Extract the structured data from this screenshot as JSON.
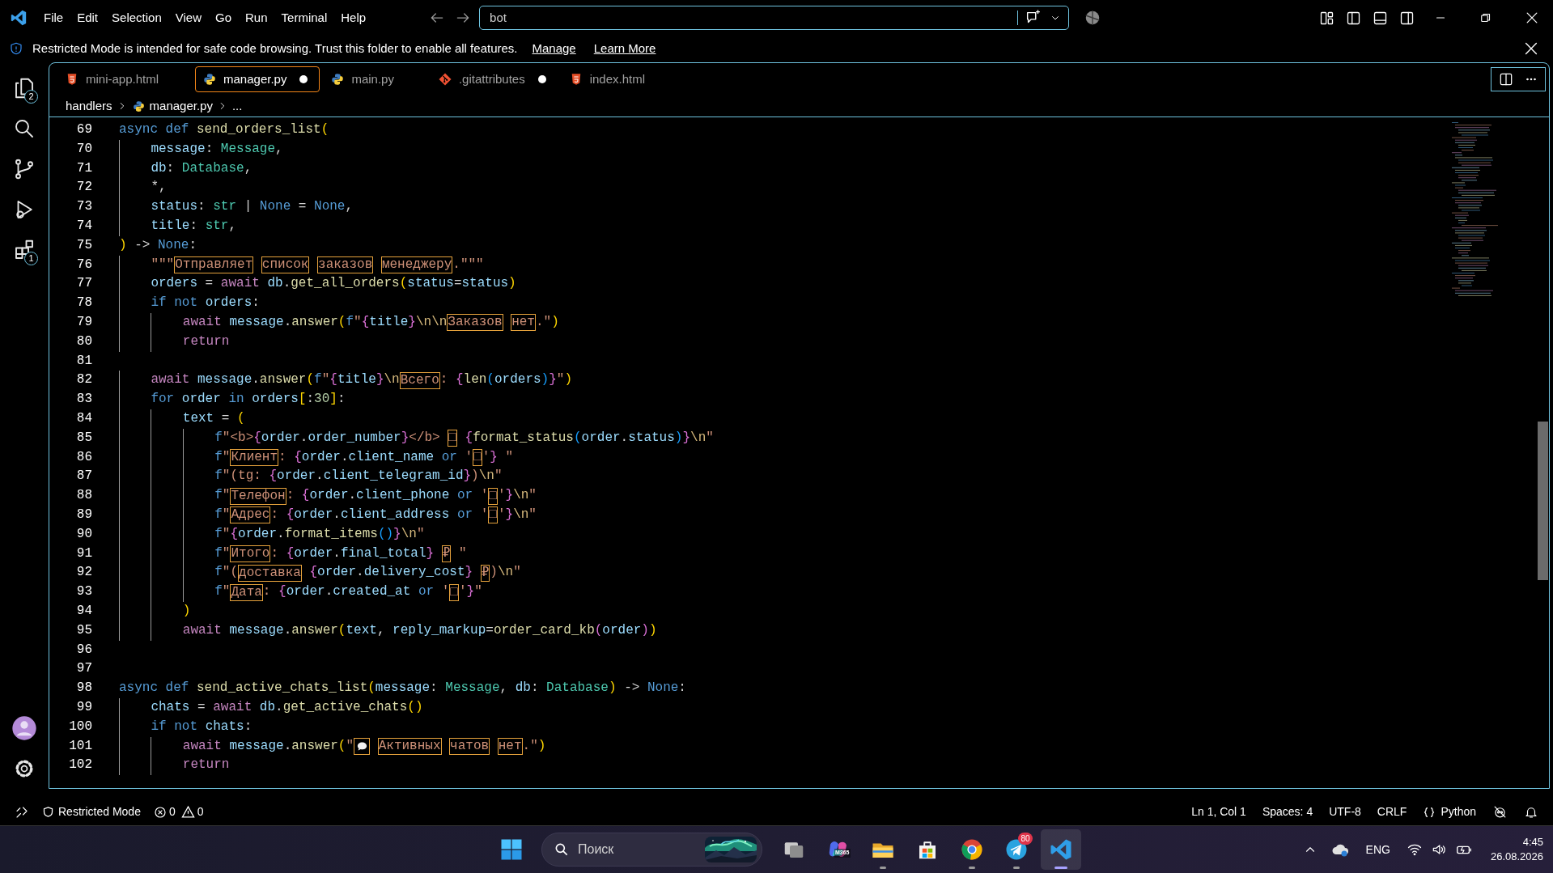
{
  "menu": [
    "File",
    "Edit",
    "Selection",
    "View",
    "Go",
    "Run",
    "Terminal",
    "Help"
  ],
  "command_center": {
    "value": "bot"
  },
  "banner": {
    "message": "Restricted Mode is intended for safe code browsing. Trust this folder to enable all features.",
    "links": [
      "Manage",
      "Learn More"
    ]
  },
  "activity_bar": [
    {
      "kind": "files",
      "badge": "2"
    },
    {
      "kind": "search"
    },
    {
      "kind": "source_control"
    },
    {
      "kind": "run"
    },
    {
      "kind": "extensions",
      "badge": "1"
    }
  ],
  "activity_bar_bottom": [
    {
      "kind": "account"
    },
    {
      "kind": "settings"
    }
  ],
  "tabs": [
    {
      "label": "mini-app.html",
      "kind": "html",
      "selected": false,
      "modified": false
    },
    {
      "label": "manager.py",
      "kind": "python",
      "selected": true,
      "modified": true
    },
    {
      "label": "main.py",
      "kind": "python",
      "selected": false,
      "modified": false
    },
    {
      "label": ".gitattributes",
      "kind": "git",
      "selected": false,
      "modified": true
    },
    {
      "label": "index.html",
      "kind": "html",
      "selected": false,
      "modified": false
    }
  ],
  "breadcrumbs": [
    {
      "label": "handlers",
      "kind": "folder"
    },
    {
      "label": "manager.py",
      "kind": "python"
    },
    {
      "label": "...",
      "kind": "symbol"
    }
  ],
  "editor": {
    "lines": [
      {
        "number": "69",
        "tokens": [
          {
            "kind": "kw",
            "text": "async def "
          },
          {
            "kind": "fn",
            "text": "send_orders_list"
          },
          {
            "kind": "b1",
            "text": "("
          }
        ]
      },
      {
        "number": "70",
        "tokens": [
          {
            "kind": "var",
            "text": "    message"
          },
          {
            "kind": "p",
            "text": ": "
          },
          {
            "kind": "type",
            "text": "Message"
          },
          {
            "kind": "p",
            "text": ","
          }
        ]
      },
      {
        "number": "71",
        "tokens": [
          {
            "kind": "var",
            "text": "    db"
          },
          {
            "kind": "p",
            "text": ": "
          },
          {
            "kind": "type",
            "text": "Database"
          },
          {
            "kind": "p",
            "text": ","
          }
        ]
      },
      {
        "number": "72",
        "tokens": [
          {
            "kind": "p",
            "text": "    *,"
          }
        ]
      },
      {
        "number": "73",
        "tokens": [
          {
            "kind": "var",
            "text": "    status"
          },
          {
            "kind": "p",
            "text": ": "
          },
          {
            "kind": "type",
            "text": "str"
          },
          {
            "kind": "p",
            "text": " | "
          },
          {
            "kind": "kw",
            "text": "None"
          },
          {
            "kind": "p",
            "text": " = "
          },
          {
            "kind": "kw",
            "text": "None"
          },
          {
            "kind": "p",
            "text": ","
          }
        ]
      },
      {
        "number": "74",
        "tokens": [
          {
            "kind": "var",
            "text": "    title"
          },
          {
            "kind": "p",
            "text": ": "
          },
          {
            "kind": "type",
            "text": "str"
          },
          {
            "kind": "p",
            "text": ","
          }
        ]
      },
      {
        "number": "75",
        "tokens": [
          {
            "kind": "b1",
            "text": ")"
          },
          {
            "kind": "p",
            "text": " -> "
          },
          {
            "kind": "kw",
            "text": "None"
          },
          {
            "kind": "p",
            "text": ":"
          }
        ]
      },
      {
        "number": "76",
        "tokens": [
          {
            "kind": "str",
            "text": "    \"\"\""
          },
          {
            "kind": "box",
            "text": "Отправляет "
          },
          {
            "kind": "box",
            "text": "список "
          },
          {
            "kind": "box",
            "text": "заказов "
          },
          {
            "kind": "box",
            "text": "менеджеру"
          },
          {
            "kind": "str",
            "text": ".\"\"\""
          }
        ]
      },
      {
        "number": "77",
        "tokens": [
          {
            "kind": "var",
            "text": "    orders"
          },
          {
            "kind": "p",
            "text": " = "
          },
          {
            "kind": "ctl",
            "text": "await "
          },
          {
            "kind": "var",
            "text": "db"
          },
          {
            "kind": "p",
            "text": "."
          },
          {
            "kind": "fn",
            "text": "get_all_orders"
          },
          {
            "kind": "b1",
            "text": "("
          },
          {
            "kind": "var",
            "text": "status"
          },
          {
            "kind": "p",
            "text": "="
          },
          {
            "kind": "var",
            "text": "status"
          },
          {
            "kind": "b1",
            "text": ")"
          }
        ]
      },
      {
        "number": "78",
        "tokens": [
          {
            "kind": "kw",
            "text": "    if not "
          },
          {
            "kind": "var",
            "text": "orders"
          },
          {
            "kind": "p",
            "text": ":"
          }
        ]
      },
      {
        "number": "79",
        "tokens": [
          {
            "kind": "ctl",
            "text": "        await "
          },
          {
            "kind": "var",
            "text": "message"
          },
          {
            "kind": "p",
            "text": "."
          },
          {
            "kind": "fn",
            "text": "answer"
          },
          {
            "kind": "b1",
            "text": "("
          },
          {
            "kind": "kw",
            "text": "f"
          },
          {
            "kind": "str",
            "text": "\""
          },
          {
            "kind": "b2",
            "text": "{"
          },
          {
            "kind": "var",
            "text": "title"
          },
          {
            "kind": "b2",
            "text": "}"
          },
          {
            "kind": "esc",
            "text": "\\n\\n"
          },
          {
            "kind": "box",
            "text": "Заказов "
          },
          {
            "kind": "box",
            "text": "нет"
          },
          {
            "kind": "str",
            "text": ".\""
          },
          {
            "kind": "b1",
            "text": ")"
          }
        ]
      },
      {
        "number": "80",
        "tokens": [
          {
            "kind": "ctl",
            "text": "        return"
          }
        ]
      },
      {
        "number": "81"
      },
      {
        "number": "82",
        "tokens": [
          {
            "kind": "ctl",
            "text": "    await "
          },
          {
            "kind": "var",
            "text": "message"
          },
          {
            "kind": "p",
            "text": "."
          },
          {
            "kind": "fn",
            "text": "answer"
          },
          {
            "kind": "b1",
            "text": "("
          },
          {
            "kind": "kw",
            "text": "f"
          },
          {
            "kind": "str",
            "text": "\""
          },
          {
            "kind": "b2",
            "text": "{"
          },
          {
            "kind": "var",
            "text": "title"
          },
          {
            "kind": "b2",
            "text": "}"
          },
          {
            "kind": "esc",
            "text": "\\n"
          },
          {
            "kind": "box",
            "text": "Всего"
          },
          {
            "kind": "str",
            "text": ": "
          },
          {
            "kind": "b2",
            "text": "{"
          },
          {
            "kind": "fn",
            "text": "len"
          },
          {
            "kind": "b3",
            "text": "("
          },
          {
            "kind": "var",
            "text": "orders"
          },
          {
            "kind": "b3",
            "text": ")"
          },
          {
            "kind": "b2",
            "text": "}"
          },
          {
            "kind": "str",
            "text": "\""
          },
          {
            "kind": "b1",
            "text": ")"
          }
        ]
      },
      {
        "number": "83",
        "tokens": [
          {
            "kind": "kw",
            "text": "    for "
          },
          {
            "kind": "var",
            "text": "order"
          },
          {
            "kind": "kw",
            "text": " in "
          },
          {
            "kind": "var",
            "text": "orders"
          },
          {
            "kind": "b1",
            "text": "["
          },
          {
            "kind": "p",
            "text": ":"
          },
          {
            "kind": "num",
            "text": "30"
          },
          {
            "kind": "b1",
            "text": "]"
          },
          {
            "kind": "p",
            "text": ":"
          }
        ]
      },
      {
        "number": "84",
        "tokens": [
          {
            "kind": "var",
            "text": "        text"
          },
          {
            "kind": "p",
            "text": " = "
          },
          {
            "kind": "b1",
            "text": "("
          }
        ]
      },
      {
        "number": "85",
        "tokens": [
          {
            "kind": "kw",
            "text": "            f"
          },
          {
            "kind": "str",
            "text": "\"<b>"
          },
          {
            "kind": "b2",
            "text": "{"
          },
          {
            "kind": "var",
            "text": "order"
          },
          {
            "kind": "p",
            "text": "."
          },
          {
            "kind": "var",
            "text": "order_number"
          },
          {
            "kind": "b2",
            "text": "}"
          },
          {
            "kind": "str",
            "text": "</b> "
          },
          {
            "kind": "box",
            "text": "□ "
          },
          {
            "kind": "b2",
            "text": "{"
          },
          {
            "kind": "fn",
            "text": "format_status"
          },
          {
            "kind": "b3",
            "text": "("
          },
          {
            "kind": "var",
            "text": "order"
          },
          {
            "kind": "p",
            "text": "."
          },
          {
            "kind": "var",
            "text": "status"
          },
          {
            "kind": "b3",
            "text": ")"
          },
          {
            "kind": "b2",
            "text": "}"
          },
          {
            "kind": "esc",
            "text": "\\n"
          },
          {
            "kind": "str",
            "text": "\""
          }
        ]
      },
      {
        "number": "86",
        "tokens": [
          {
            "kind": "kw",
            "text": "            f"
          },
          {
            "kind": "str",
            "text": "\""
          },
          {
            "kind": "box",
            "text": "Клиент"
          },
          {
            "kind": "str",
            "text": ": "
          },
          {
            "kind": "b2",
            "text": "{"
          },
          {
            "kind": "var",
            "text": "order"
          },
          {
            "kind": "p",
            "text": "."
          },
          {
            "kind": "var",
            "text": "client_name"
          },
          {
            "kind": "kw",
            "text": " or "
          },
          {
            "kind": "str",
            "text": "'"
          },
          {
            "kind": "box",
            "text": "□"
          },
          {
            "kind": "str",
            "text": "'"
          },
          {
            "kind": "b2",
            "text": "}"
          },
          {
            "kind": "str",
            "text": " \""
          }
        ]
      },
      {
        "number": "87",
        "tokens": [
          {
            "kind": "kw",
            "text": "            f"
          },
          {
            "kind": "str",
            "text": "\"(tg: "
          },
          {
            "kind": "b2",
            "text": "{"
          },
          {
            "kind": "var",
            "text": "order"
          },
          {
            "kind": "p",
            "text": "."
          },
          {
            "kind": "var",
            "text": "client_telegram_id"
          },
          {
            "kind": "b2",
            "text": "}"
          },
          {
            "kind": "str",
            "text": ")"
          },
          {
            "kind": "esc",
            "text": "\\n"
          },
          {
            "kind": "str",
            "text": "\""
          }
        ]
      },
      {
        "number": "88",
        "tokens": [
          {
            "kind": "kw",
            "text": "            f"
          },
          {
            "kind": "str",
            "text": "\""
          },
          {
            "kind": "box",
            "text": "Телефон"
          },
          {
            "kind": "str",
            "text": ": "
          },
          {
            "kind": "b2",
            "text": "{"
          },
          {
            "kind": "var",
            "text": "order"
          },
          {
            "kind": "p",
            "text": "."
          },
          {
            "kind": "var",
            "text": "client_phone"
          },
          {
            "kind": "kw",
            "text": " or "
          },
          {
            "kind": "str",
            "text": "'"
          },
          {
            "kind": "box",
            "text": "□"
          },
          {
            "kind": "str",
            "text": "'"
          },
          {
            "kind": "b2",
            "text": "}"
          },
          {
            "kind": "esc",
            "text": "\\n"
          },
          {
            "kind": "str",
            "text": "\""
          }
        ]
      },
      {
        "number": "89",
        "tokens": [
          {
            "kind": "kw",
            "text": "            f"
          },
          {
            "kind": "str",
            "text": "\""
          },
          {
            "kind": "box",
            "text": "Адрес"
          },
          {
            "kind": "str",
            "text": ": "
          },
          {
            "kind": "b2",
            "text": "{"
          },
          {
            "kind": "var",
            "text": "order"
          },
          {
            "kind": "p",
            "text": "."
          },
          {
            "kind": "var",
            "text": "client_address"
          },
          {
            "kind": "kw",
            "text": " or "
          },
          {
            "kind": "str",
            "text": "'"
          },
          {
            "kind": "box",
            "text": "□"
          },
          {
            "kind": "str",
            "text": "'"
          },
          {
            "kind": "b2",
            "text": "}"
          },
          {
            "kind": "esc",
            "text": "\\n"
          },
          {
            "kind": "str",
            "text": "\""
          }
        ]
      },
      {
        "number": "90",
        "tokens": [
          {
            "kind": "kw",
            "text": "            f"
          },
          {
            "kind": "str",
            "text": "\""
          },
          {
            "kind": "b2",
            "text": "{"
          },
          {
            "kind": "var",
            "text": "order"
          },
          {
            "kind": "p",
            "text": "."
          },
          {
            "kind": "fn",
            "text": "format_items"
          },
          {
            "kind": "b3",
            "text": "()"
          },
          {
            "kind": "b2",
            "text": "}"
          },
          {
            "kind": "esc",
            "text": "\\n"
          },
          {
            "kind": "str",
            "text": "\""
          }
        ]
      },
      {
        "number": "91",
        "tokens": [
          {
            "kind": "kw",
            "text": "            f"
          },
          {
            "kind": "str",
            "text": "\""
          },
          {
            "kind": "box",
            "text": "Итого"
          },
          {
            "kind": "str",
            "text": ": "
          },
          {
            "kind": "b2",
            "text": "{"
          },
          {
            "kind": "var",
            "text": "order"
          },
          {
            "kind": "p",
            "text": "."
          },
          {
            "kind": "var",
            "text": "final_total"
          },
          {
            "kind": "b2",
            "text": "} "
          },
          {
            "kind": "box",
            "text": "₽"
          },
          {
            "kind": "str",
            "text": " \""
          }
        ]
      },
      {
        "number": "92",
        "tokens": [
          {
            "kind": "kw",
            "text": "            f"
          },
          {
            "kind": "str",
            "text": "\"("
          },
          {
            "kind": "box",
            "text": "доставка "
          },
          {
            "kind": "b2",
            "text": "{"
          },
          {
            "kind": "var",
            "text": "order"
          },
          {
            "kind": "p",
            "text": "."
          },
          {
            "kind": "var",
            "text": "delivery_cost"
          },
          {
            "kind": "b2",
            "text": "} "
          },
          {
            "kind": "box",
            "text": "₽"
          },
          {
            "kind": "str",
            "text": ")"
          },
          {
            "kind": "esc",
            "text": "\\n"
          },
          {
            "kind": "str",
            "text": "\""
          }
        ]
      },
      {
        "number": "93",
        "tokens": [
          {
            "kind": "kw",
            "text": "            f"
          },
          {
            "kind": "str",
            "text": "\""
          },
          {
            "kind": "box",
            "text": "Дата"
          },
          {
            "kind": "str",
            "text": ": "
          },
          {
            "kind": "b2",
            "text": "{"
          },
          {
            "kind": "var",
            "text": "order"
          },
          {
            "kind": "p",
            "text": "."
          },
          {
            "kind": "var",
            "text": "created_at"
          },
          {
            "kind": "kw",
            "text": " or "
          },
          {
            "kind": "str",
            "text": "'"
          },
          {
            "kind": "box",
            "text": "□"
          },
          {
            "kind": "str",
            "text": "'"
          },
          {
            "kind": "b2",
            "text": "}"
          },
          {
            "kind": "str",
            "text": "\""
          }
        ]
      },
      {
        "number": "94",
        "tokens": [
          {
            "kind": "b1",
            "text": "        )"
          }
        ]
      },
      {
        "number": "95",
        "tokens": [
          {
            "kind": "ctl",
            "text": "        await "
          },
          {
            "kind": "var",
            "text": "message"
          },
          {
            "kind": "p",
            "text": "."
          },
          {
            "kind": "fn",
            "text": "answer"
          },
          {
            "kind": "b1",
            "text": "("
          },
          {
            "kind": "var",
            "text": "text"
          },
          {
            "kind": "p",
            "text": ", "
          },
          {
            "kind": "var",
            "text": "reply_markup"
          },
          {
            "kind": "p",
            "text": "="
          },
          {
            "kind": "fn",
            "text": "order_card_kb"
          },
          {
            "kind": "b2",
            "text": "("
          },
          {
            "kind": "var",
            "text": "order"
          },
          {
            "kind": "b2",
            "text": ")"
          },
          {
            "kind": "b1",
            "text": ")"
          }
        ]
      },
      {
        "number": "96"
      },
      {
        "number": "97"
      },
      {
        "number": "98",
        "tokens": [
          {
            "kind": "kw",
            "text": "async def "
          },
          {
            "kind": "fn",
            "text": "send_active_chats_list"
          },
          {
            "kind": "b1",
            "text": "("
          },
          {
            "kind": "var",
            "text": "message"
          },
          {
            "kind": "p",
            "text": ": "
          },
          {
            "kind": "type",
            "text": "Message"
          },
          {
            "kind": "p",
            "text": ", "
          },
          {
            "kind": "var",
            "text": "db"
          },
          {
            "kind": "p",
            "text": ": "
          },
          {
            "kind": "type",
            "text": "Database"
          },
          {
            "kind": "b1",
            "text": ")"
          },
          {
            "kind": "p",
            "text": " -> "
          },
          {
            "kind": "kw",
            "text": "None"
          },
          {
            "kind": "p",
            "text": ":"
          }
        ]
      },
      {
        "number": "99",
        "tokens": [
          {
            "kind": "var",
            "text": "    chats"
          },
          {
            "kind": "p",
            "text": " = "
          },
          {
            "kind": "ctl",
            "text": "await "
          },
          {
            "kind": "var",
            "text": "db"
          },
          {
            "kind": "p",
            "text": "."
          },
          {
            "kind": "fn",
            "text": "get_active_chats"
          },
          {
            "kind": "b1",
            "text": "()"
          }
        ]
      },
      {
        "number": "100",
        "tokens": [
          {
            "kind": "kw",
            "text": "    if not "
          },
          {
            "kind": "var",
            "text": "chats"
          },
          {
            "kind": "p",
            "text": ":"
          }
        ]
      },
      {
        "number": "101",
        "tokens": [
          {
            "kind": "ctl",
            "text": "        await "
          },
          {
            "kind": "var",
            "text": "message"
          },
          {
            "kind": "p",
            "text": "."
          },
          {
            "kind": "fn",
            "text": "answer"
          },
          {
            "kind": "b1",
            "text": "("
          },
          {
            "kind": "str",
            "text": "\""
          },
          {
            "kind": "emoji"
          },
          {
            "kind": "box",
            "text": " Активных "
          },
          {
            "kind": "box",
            "text": "чатов "
          },
          {
            "kind": "box",
            "text": "нет"
          },
          {
            "kind": "str",
            "text": ".\""
          },
          {
            "kind": "b1",
            "text": ")"
          }
        ]
      },
      {
        "number": "102",
        "tokens": [
          {
            "kind": "ctl",
            "text": "        return"
          }
        ]
      }
    ]
  },
  "status_bar": {
    "left": [
      {
        "kind": "remote"
      },
      {
        "kind": "restricted",
        "label": "Restricted Mode"
      },
      {
        "kind": "problems",
        "errors": "0",
        "warnings": "0"
      }
    ],
    "right": [
      {
        "kind": "text",
        "label": "Ln 1, Col 1"
      },
      {
        "kind": "text",
        "label": "Spaces: 4"
      },
      {
        "kind": "text",
        "label": "UTF-8"
      },
      {
        "kind": "text",
        "label": "CRLF"
      },
      {
        "kind": "language",
        "label": "Python"
      },
      {
        "kind": "copilot"
      },
      {
        "kind": "bell"
      }
    ]
  },
  "taskbar": {
    "search": {
      "placeholder": "Поиск"
    },
    "apps": [
      {
        "kind": "task_view",
        "running": false,
        "selected": false
      },
      {
        "kind": "m365",
        "label": "M365",
        "running": false,
        "selected": false
      },
      {
        "kind": "explorer",
        "running": true,
        "selected": false
      },
      {
        "kind": "store",
        "running": false,
        "selected": false
      },
      {
        "kind": "browser",
        "running": true,
        "selected": false
      },
      {
        "kind": "telegram",
        "badge": "80",
        "running": true,
        "selected": false
      },
      {
        "kind": "vscode",
        "running": true,
        "selected": true
      }
    ],
    "tray": {
      "language": "ENG",
      "time": "4:45",
      "date": "26.08.2026"
    }
  }
}
